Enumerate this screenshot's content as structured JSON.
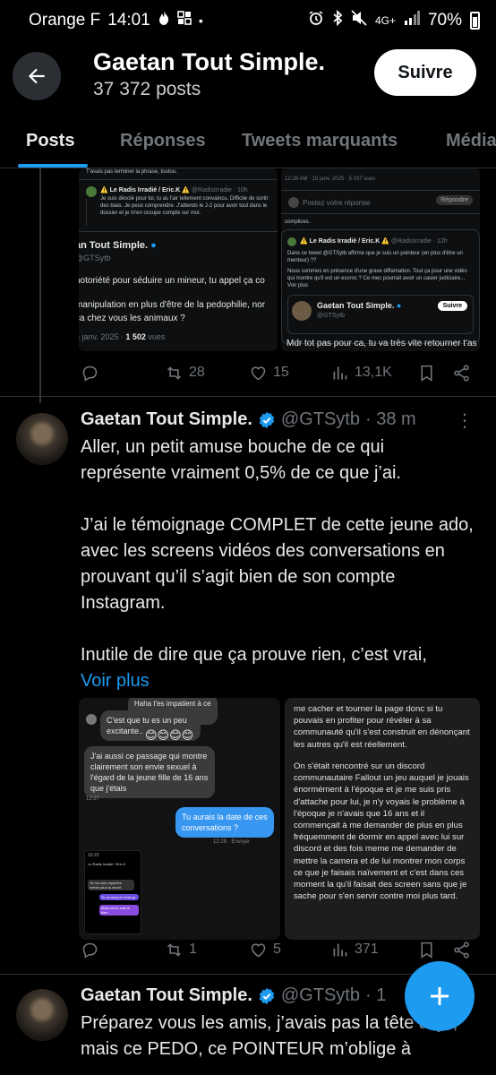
{
  "status_bar": {
    "carrier": "Orange F",
    "time": "14:01",
    "network": "4G+",
    "battery": "70%"
  },
  "header": {
    "title": "Gaetan Tout Simple.",
    "posts_count": "37 372 posts",
    "follow_label": "Suivre"
  },
  "tabs": [
    {
      "label": "Posts",
      "active": true
    },
    {
      "label": "Réponses",
      "active": false
    },
    {
      "label": "Tweets marquants",
      "active": false
    },
    {
      "label": "Média",
      "active": false
    }
  ],
  "top_post": {
    "media": {
      "a_topline": "T'avais pas terminer la phrase, toutou.",
      "a_reply_author": "⚠️ Le Radis Irradié / Eric.K ⚠️",
      "a_reply_handle": "@RadisIrradie · 10h",
      "a_reply_text": "Je suis désolé pour toi, tu as l'air tellement convaincu. Difficile de sortir des biais. Je peux comprendre. J'attends le J-2 pour avoir tout dans le dossier et je m'en occupe compte sur moi.",
      "a_quoted_name": "an Tout Simple.",
      "a_quoted_handle": "@GTSytb",
      "a_quoted_line1": "notoriété pour séduire un mineur, tu appel ça co",
      "a_quoted_line2": "manipulation en plus d'être de la pedophilie, nor",
      "a_quoted_line3": "ça chez vous les animaux ?",
      "a_quoted_date": "5 janv. 2025 · ",
      "a_quoted_views_num": "1 502",
      "a_quoted_views_label": " vues",
      "b_meta": "12:28 AM · 15 janv. 2025 · 5 037 vues",
      "b_reply_placeholder": "Postez votre réponse",
      "b_reply_button": "Répondre",
      "b_complices": "complices.",
      "b_reply_author": "⚠️ Le Radis Irradié / Eric.K ⚠️",
      "b_reply_handle": "@RadisIrradie · 12h",
      "b_reply_text1": "Dans ce tweet @GTSytb affirme que je suis un pointeur (en plus d'être un menteur) ??",
      "b_reply_text2": "Nous sommes en présence d'une grave diffamation. Tout ça pour une vidéo qui montre qu'il est un escroc ? Ce mec pourrait avoir un casier judiciaire... Voir plus",
      "b_card_name": "Gaetan Tout Simple.",
      "b_card_handle": "@GTSytb",
      "b_card_follow": "Suivre",
      "b_bottom_text": "Mdr tot pas pour ca, tu va très vite retourner t'as"
    },
    "actions": {
      "retweets": "28",
      "likes": "15",
      "views": "13,1K"
    }
  },
  "post1": {
    "author": "Gaetan Tout Simple.",
    "handle": "@GTSytb",
    "time": "· 38 m",
    "text1": "Aller, un petit amuse bouche de ce qui représente vraiment 0,5% de ce que j’ai.",
    "text2": "J’ai le témoignage COMPLET de cette jeune ado, avec les screens vidéos des conversations en prouvant qu’il s’agit bien de son compte Instagram.",
    "text3": "Inutile de dire que ça prouve rien, c’est vrai,",
    "voir_plus": "Voir plus",
    "chat": {
      "top_cut": "Haha t'es impatient à ce que je vais",
      "msg1": "C'est que tu es un peu excitante..",
      "emojis": "😊😊😊😊",
      "msg2": "J'ai aussi ce passage qui montre clairement son envie sexuel à l'égard de la jeune fille de 16 ans que j'étais",
      "time1": "12:27",
      "msg3": "Tu aurais la date de ces conversations ?",
      "time2": "12:29 · Envoyé",
      "mini_time": "10:22",
      "mini_title": "Le Radis Irradié / Eric.K",
      "mini_msg1": "Je me suis rappelée même plus tu serait",
      "mini_msg2": "Tu es sexy et c'est ça",
      "mini_msg3": "Mais oui tu sais le bien"
    },
    "testimony": {
      "top": "me cacher et tourner la page donc si tu pouvais en profiter pour révéler à sa communauté qu'il s'est construit en dénonçant les autres qu'il est réellement.",
      "body": "On s'était rencontré sur un discord communautaire Fallout un jeu auquel je jouais énormément à l'époque et je me suis pris d'attache pour lui, je n'y voyais le problème à l'époque je n'avais que 16 ans et il commençait à me demander de plus en plus fréquemment de dormir en appel avec lui sur discord et des fois meme me demander de mettre la camera et de lui montrer mon corps ce que je faisais naïvement et c'est dans ces moment la qu'il faisait des screen sans que je sache pour s'en servir contre moi plus tard."
    },
    "actions": {
      "retweets": "1",
      "likes": "5",
      "views": "371"
    }
  },
  "post2": {
    "author": "Gaetan Tout Simple.",
    "handle": "@GTSytb",
    "time": "· 1",
    "text": "Préparez vous les amis, j’avais pas la tête à ça, mais ce PEDO, ce POINTEUR m’oblige à"
  },
  "colors": {
    "accent": "#1d9bf0",
    "background": "#000000",
    "secondary_text": "#71767b"
  }
}
